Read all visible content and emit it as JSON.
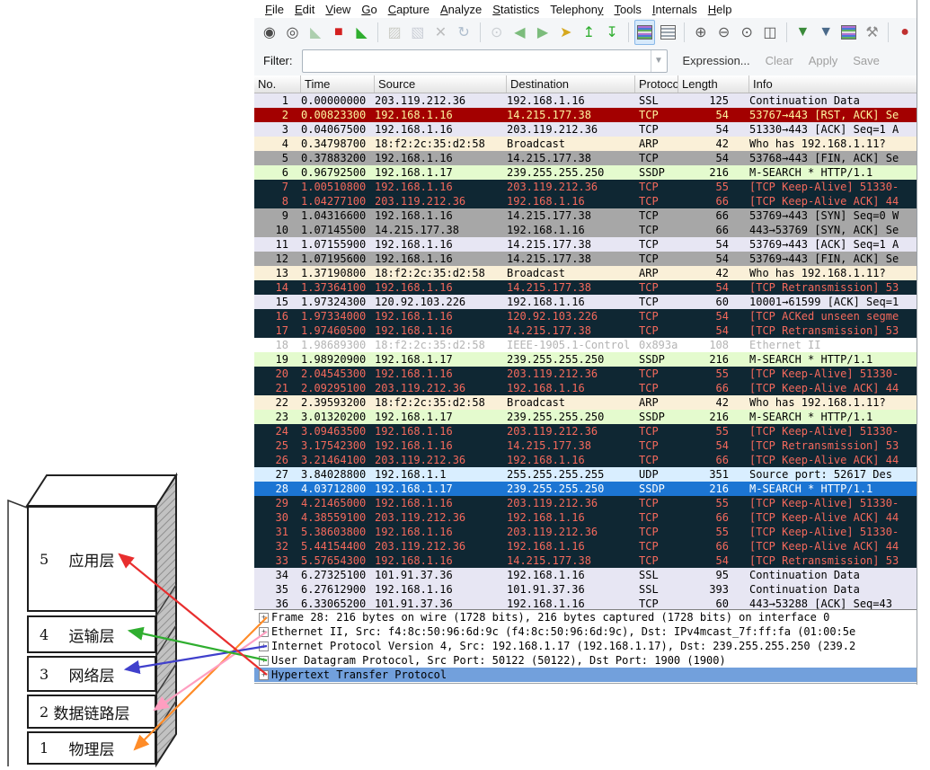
{
  "app": "Wireshark",
  "menubar": {
    "items": [
      {
        "label": "File",
        "underline": 0
      },
      {
        "label": "Edit",
        "underline": 0
      },
      {
        "label": "View",
        "underline": 0
      },
      {
        "label": "Go",
        "underline": 0
      },
      {
        "label": "Capture",
        "underline": 0
      },
      {
        "label": "Analyze",
        "underline": 0
      },
      {
        "label": "Statistics",
        "underline": 0
      },
      {
        "label": "Telephony",
        "underline": 8
      },
      {
        "label": "Tools",
        "underline": 0
      },
      {
        "label": "Internals",
        "underline": 0
      },
      {
        "label": "Help",
        "underline": 0
      }
    ]
  },
  "toolbar": {
    "icons": [
      {
        "name": "list-interfaces-icon",
        "glyph": "◉",
        "color": "#4a4a4a"
      },
      {
        "name": "capture-options-icon",
        "glyph": "◎",
        "color": "#4a4a4a"
      },
      {
        "name": "start-capture-icon",
        "glyph": "◣",
        "color": "#58a058",
        "disabled": true
      },
      {
        "name": "stop-capture-icon",
        "glyph": "■",
        "color": "#d42020"
      },
      {
        "name": "restart-capture-icon",
        "glyph": "◣",
        "color": "#2fae2f"
      },
      {
        "name": "separator"
      },
      {
        "name": "open-file-icon",
        "glyph": "▨",
        "color": "#9a9a8a",
        "disabled": true
      },
      {
        "name": "save-file-icon",
        "glyph": "▧",
        "color": "#9aa0b0",
        "disabled": true
      },
      {
        "name": "close-file-icon",
        "glyph": "✕",
        "color": "#777777",
        "disabled": true
      },
      {
        "name": "reload-icon",
        "glyph": "↻",
        "color": "#5a7a9a",
        "disabled": true
      },
      {
        "name": "separator"
      },
      {
        "name": "find-packet-icon",
        "glyph": "⊙",
        "color": "#9aa0a8",
        "disabled": true
      },
      {
        "name": "go-back-icon",
        "glyph": "◀",
        "color": "#7cbc7c"
      },
      {
        "name": "go-forward-icon",
        "glyph": "▶",
        "color": "#7cbc7c"
      },
      {
        "name": "go-to-packet-icon",
        "glyph": "➤",
        "color": "#d6a81e"
      },
      {
        "name": "go-to-top-icon",
        "glyph": "↥",
        "color": "#2fae2f"
      },
      {
        "name": "go-to-bottom-icon",
        "glyph": "↧",
        "color": "#2fae2f"
      },
      {
        "name": "separator"
      },
      {
        "name": "colorize-icon",
        "type": "stripes",
        "active": true
      },
      {
        "name": "autoscroll-icon",
        "type": "listbox"
      },
      {
        "name": "separator"
      },
      {
        "name": "zoom-in-icon",
        "glyph": "⊕",
        "color": "#5a5a5a"
      },
      {
        "name": "zoom-out-icon",
        "glyph": "⊖",
        "color": "#5a5a5a"
      },
      {
        "name": "zoom-100-icon",
        "glyph": "⊙",
        "color": "#5a5a5a"
      },
      {
        "name": "resize-columns-icon",
        "glyph": "◫",
        "color": "#5a5a5a"
      },
      {
        "name": "separator"
      },
      {
        "name": "capture-filters-icon",
        "glyph": "▼",
        "color": "#3a8a3a"
      },
      {
        "name": "display-filters-icon",
        "glyph": "▼",
        "color": "#4a6a8a"
      },
      {
        "name": "coloring-rules-icon",
        "type": "stripes"
      },
      {
        "name": "preferences-icon",
        "glyph": "⚒",
        "color": "#8a8a8a"
      },
      {
        "name": "separator"
      },
      {
        "name": "help-icon",
        "glyph": "●",
        "color": "#c03030"
      }
    ]
  },
  "filterbar": {
    "label": "Filter:",
    "input_value": "",
    "buttons": [
      {
        "name": "expression-button",
        "label": "Expression...",
        "dark": true
      },
      {
        "name": "clear-button",
        "label": "Clear",
        "dark": false
      },
      {
        "name": "apply-button",
        "label": "Apply",
        "dark": false
      },
      {
        "name": "save-button",
        "label": "Save",
        "dark": false
      }
    ]
  },
  "packet_list": {
    "columns": [
      "No.",
      "Time",
      "Source",
      "Destination",
      "Protocol",
      "Length",
      "Info"
    ],
    "packets": [
      {
        "no": "1",
        "time": "0.00000000",
        "src": "203.119.212.36",
        "dst": "192.168.1.16",
        "proto": "SSL",
        "len": "125",
        "info": "Continuation Data",
        "style": "default"
      },
      {
        "no": "2",
        "time": "0.00823300",
        "src": "192.168.1.16",
        "dst": "14.215.177.38",
        "proto": "TCP",
        "len": "54",
        "info": "53767→443 [RST, ACK] Se",
        "style": "rst"
      },
      {
        "no": "3",
        "time": "0.04067500",
        "src": "192.168.1.16",
        "dst": "203.119.212.36",
        "proto": "TCP",
        "len": "54",
        "info": "51330→443 [ACK] Seq=1 A",
        "style": "default"
      },
      {
        "no": "4",
        "time": "0.34798700",
        "src": "18:f2:2c:35:d2:58",
        "dst": "Broadcast",
        "proto": "ARP",
        "len": "42",
        "info": "Who has 192.168.1.11?",
        "style": "arp"
      },
      {
        "no": "5",
        "time": "0.37883200",
        "src": "192.168.1.16",
        "dst": "14.215.177.38",
        "proto": "TCP",
        "len": "54",
        "info": "53768→443 [FIN, ACK] Se",
        "style": "gray"
      },
      {
        "no": "6",
        "time": "0.96792500",
        "src": "192.168.1.17",
        "dst": "239.255.255.250",
        "proto": "SSDP",
        "len": "216",
        "info": "M-SEARCH * HTTP/1.1",
        "style": "ssdp"
      },
      {
        "no": "7",
        "time": "1.00510800",
        "src": "192.168.1.16",
        "dst": "203.119.212.36",
        "proto": "TCP",
        "len": "55",
        "info": "[TCP Keep-Alive] 51330-",
        "style": "badtcp"
      },
      {
        "no": "8",
        "time": "1.04277100",
        "src": "203.119.212.36",
        "dst": "192.168.1.16",
        "proto": "TCP",
        "len": "66",
        "info": "[TCP Keep-Alive ACK] 44",
        "style": "badtcp"
      },
      {
        "no": "9",
        "time": "1.04316600",
        "src": "192.168.1.16",
        "dst": "14.215.177.38",
        "proto": "TCP",
        "len": "66",
        "info": "53769→443 [SYN] Seq=0 W",
        "style": "gray"
      },
      {
        "no": "10",
        "time": "1.07145500",
        "src": "14.215.177.38",
        "dst": "192.168.1.16",
        "proto": "TCP",
        "len": "66",
        "info": "443→53769 [SYN, ACK] Se",
        "style": "gray"
      },
      {
        "no": "11",
        "time": "1.07155900",
        "src": "192.168.1.16",
        "dst": "14.215.177.38",
        "proto": "TCP",
        "len": "54",
        "info": "53769→443 [ACK] Seq=1 A",
        "style": "default"
      },
      {
        "no": "12",
        "time": "1.07195600",
        "src": "192.168.1.16",
        "dst": "14.215.177.38",
        "proto": "TCP",
        "len": "54",
        "info": "53769→443 [FIN, ACK] Se",
        "style": "gray"
      },
      {
        "no": "13",
        "time": "1.37190800",
        "src": "18:f2:2c:35:d2:58",
        "dst": "Broadcast",
        "proto": "ARP",
        "len": "42",
        "info": "Who has 192.168.1.11?",
        "style": "arp"
      },
      {
        "no": "14",
        "time": "1.37364100",
        "src": "192.168.1.16",
        "dst": "14.215.177.38",
        "proto": "TCP",
        "len": "54",
        "info": "[TCP Retransmission] 53",
        "style": "badtcp"
      },
      {
        "no": "15",
        "time": "1.97324300",
        "src": "120.92.103.226",
        "dst": "192.168.1.16",
        "proto": "TCP",
        "len": "60",
        "info": "10001→61599 [ACK] Seq=1",
        "style": "default"
      },
      {
        "no": "16",
        "time": "1.97334000",
        "src": "192.168.1.16",
        "dst": "120.92.103.226",
        "proto": "TCP",
        "len": "54",
        "info": "[TCP ACKed unseen segme",
        "style": "badtcp"
      },
      {
        "no": "17",
        "time": "1.97460500",
        "src": "192.168.1.16",
        "dst": "14.215.177.38",
        "proto": "TCP",
        "len": "54",
        "info": "[TCP Retransmission] 53",
        "style": "badtcp"
      },
      {
        "no": "18",
        "time": "1.98689300",
        "src": "18:f2:2c:35:d2:58",
        "dst": "IEEE-1905.1-Control",
        "proto": "0x893a",
        "len": "108",
        "info": "Ethernet II",
        "style": "ignored"
      },
      {
        "no": "19",
        "time": "1.98920900",
        "src": "192.168.1.17",
        "dst": "239.255.255.250",
        "proto": "SSDP",
        "len": "216",
        "info": "M-SEARCH * HTTP/1.1",
        "style": "ssdp"
      },
      {
        "no": "20",
        "time": "2.04545300",
        "src": "192.168.1.16",
        "dst": "203.119.212.36",
        "proto": "TCP",
        "len": "55",
        "info": "[TCP Keep-Alive] 51330-",
        "style": "badtcp"
      },
      {
        "no": "21",
        "time": "2.09295100",
        "src": "203.119.212.36",
        "dst": "192.168.1.16",
        "proto": "TCP",
        "len": "66",
        "info": "[TCP Keep-Alive ACK] 44",
        "style": "badtcp"
      },
      {
        "no": "22",
        "time": "2.39593200",
        "src": "18:f2:2c:35:d2:58",
        "dst": "Broadcast",
        "proto": "ARP",
        "len": "42",
        "info": "Who has 192.168.1.11?",
        "style": "arp"
      },
      {
        "no": "23",
        "time": "3.01320200",
        "src": "192.168.1.17",
        "dst": "239.255.255.250",
        "proto": "SSDP",
        "len": "216",
        "info": "M-SEARCH * HTTP/1.1",
        "style": "ssdp"
      },
      {
        "no": "24",
        "time": "3.09463500",
        "src": "192.168.1.16",
        "dst": "203.119.212.36",
        "proto": "TCP",
        "len": "55",
        "info": "[TCP Keep-Alive] 51330-",
        "style": "badtcp"
      },
      {
        "no": "25",
        "time": "3.17542300",
        "src": "192.168.1.16",
        "dst": "14.215.177.38",
        "proto": "TCP",
        "len": "54",
        "info": "[TCP Retransmission] 53",
        "style": "badtcp"
      },
      {
        "no": "26",
        "time": "3.21464100",
        "src": "203.119.212.36",
        "dst": "192.168.1.16",
        "proto": "TCP",
        "len": "66",
        "info": "[TCP Keep-Alive ACK] 44",
        "style": "badtcp"
      },
      {
        "no": "27",
        "time": "3.84028800",
        "src": "192.168.1.1",
        "dst": "255.255.255.255",
        "proto": "UDP",
        "len": "351",
        "info": "Source port: 52617  Des",
        "style": "udp"
      },
      {
        "no": "28",
        "time": "4.03712800",
        "src": "192.168.1.17",
        "dst": "239.255.255.250",
        "proto": "SSDP",
        "len": "216",
        "info": "M-SEARCH * HTTP/1.1",
        "style": "selected"
      },
      {
        "no": "29",
        "time": "4.21465000",
        "src": "192.168.1.16",
        "dst": "203.119.212.36",
        "proto": "TCP",
        "len": "55",
        "info": "[TCP Keep-Alive] 51330-",
        "style": "badtcp"
      },
      {
        "no": "30",
        "time": "4.38559100",
        "src": "203.119.212.36",
        "dst": "192.168.1.16",
        "proto": "TCP",
        "len": "66",
        "info": "[TCP Keep-Alive ACK] 44",
        "style": "badtcp"
      },
      {
        "no": "31",
        "time": "5.38603800",
        "src": "192.168.1.16",
        "dst": "203.119.212.36",
        "proto": "TCP",
        "len": "55",
        "info": "[TCP Keep-Alive] 51330-",
        "style": "badtcp"
      },
      {
        "no": "32",
        "time": "5.44154400",
        "src": "203.119.212.36",
        "dst": "192.168.1.16",
        "proto": "TCP",
        "len": "66",
        "info": "[TCP Keep-Alive ACK] 44",
        "style": "badtcp"
      },
      {
        "no": "33",
        "time": "5.57654300",
        "src": "192.168.1.16",
        "dst": "14.215.177.38",
        "proto": "TCP",
        "len": "54",
        "info": "[TCP Retransmission] 53",
        "style": "badtcp"
      },
      {
        "no": "34",
        "time": "6.27325100",
        "src": "101.91.37.36",
        "dst": "192.168.1.16",
        "proto": "SSL",
        "len": "95",
        "info": "Continuation Data",
        "style": "default"
      },
      {
        "no": "35",
        "time": "6.27612900",
        "src": "192.168.1.16",
        "dst": "101.91.37.36",
        "proto": "SSL",
        "len": "393",
        "info": "Continuation Data",
        "style": "default"
      },
      {
        "no": "36",
        "time": "6.33065200",
        "src": "101.91.37.36",
        "dst": "192.168.1.16",
        "proto": "TCP",
        "len": "60",
        "info": "443→53288 [ACK] Seq=43",
        "style": "default"
      }
    ]
  },
  "detail_pane": {
    "rows": [
      {
        "text": "Frame 28: 216 bytes on wire (1728 bits), 216 bytes captured (1728 bits) on interface 0",
        "selected": false
      },
      {
        "text": "Ethernet II, Src: f4:8c:50:96:6d:9c (f4:8c:50:96:6d:9c), Dst: IPv4mcast_7f:ff:fa (01:00:5e",
        "selected": false
      },
      {
        "text": "Internet Protocol Version 4, Src: 192.168.1.17 (192.168.1.17), Dst: 239.255.255.250 (239.2",
        "selected": false
      },
      {
        "text": "User Datagram Protocol, Src Port: 50122 (50122), Dst Port: 1900 (1900)",
        "selected": false
      },
      {
        "text": "Hypertext Transfer Protocol",
        "selected": true
      }
    ]
  },
  "diagram": {
    "layers": [
      {
        "number": "5",
        "label": "应用层"
      },
      {
        "number": "4",
        "label": "运输层"
      },
      {
        "number": "3",
        "label": "网络层"
      },
      {
        "number": "2",
        "label": "数据链路层"
      },
      {
        "number": "1",
        "label": "物理层"
      }
    ],
    "arrows": [
      {
        "name": "frame-to-physical-arrow",
        "color": "#ff8c28",
        "from_row": "Frame 28",
        "to_layer": "物理层"
      },
      {
        "name": "ethernet-to-datalink-arrow",
        "color": "#ff9ec0",
        "from_row": "Ethernet II",
        "to_layer": "数据链路层"
      },
      {
        "name": "ip-to-network-arrow",
        "color": "#4040cc",
        "from_row": "Internet Protocol Version 4",
        "to_layer": "网络层"
      },
      {
        "name": "udp-to-transport-arrow",
        "color": "#2fae2f",
        "from_row": "User Datagram Protocol",
        "to_layer": "运输层"
      },
      {
        "name": "http-to-application-arrow",
        "color": "#e82e2e",
        "from_row": "Hypertext Transfer Protocol",
        "to_layer": "应用层"
      }
    ]
  },
  "colors": {
    "selected_row_bg": "#1c75d3",
    "selected_row_fg": "#ffffff",
    "bad_tcp_bg": "#0f2733",
    "bad_tcp_fg": "#f4695c",
    "rst_bg": "#a30000",
    "rst_fg": "#fdf6a0",
    "arp_bg": "#faf0d8",
    "ssdp_bg": "#e4fbce",
    "udp_bg": "#d9eeff",
    "default_bg": "#e7e6f3",
    "gray_bg": "#a7a7a7",
    "ignored_fg": "#b4b4b4",
    "detail_selected_bg": "#72a0dc",
    "toolbar_active_bg": "#d6e9fb"
  }
}
